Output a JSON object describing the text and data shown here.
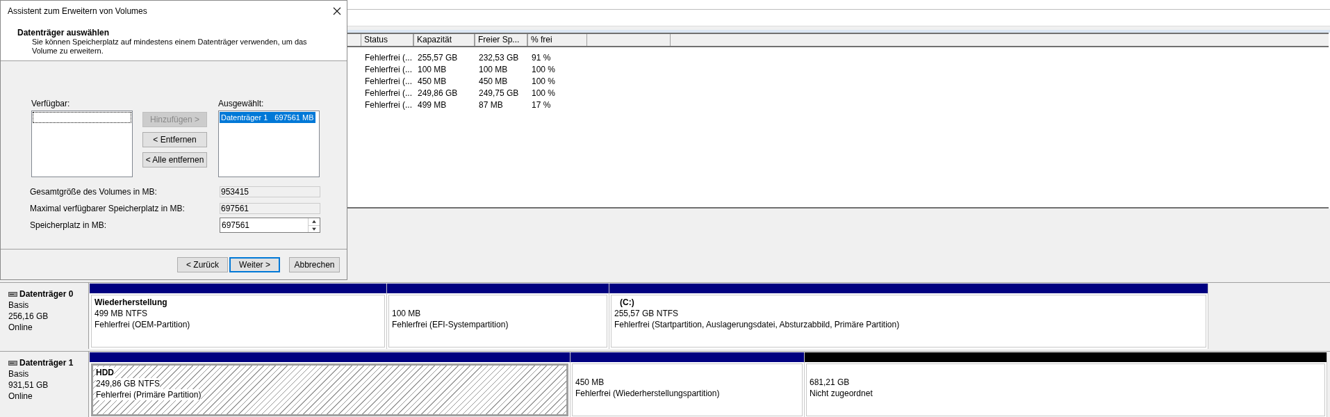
{
  "table": {
    "columns": [
      "Status",
      "Kapazität",
      "Freier Sp...",
      "% frei"
    ],
    "rows": [
      [
        "Fehlerfrei (...",
        "255,57 GB",
        "232,53 GB",
        "91 %"
      ],
      [
        "Fehlerfrei (...",
        "100 MB",
        "100 MB",
        "100 %"
      ],
      [
        "Fehlerfrei (...",
        "450 MB",
        "450 MB",
        "100 %"
      ],
      [
        "Fehlerfrei (...",
        "249,86 GB",
        "249,75 GB",
        "100 %"
      ],
      [
        "Fehlerfrei (...",
        "499 MB",
        "87 MB",
        "17 %"
      ]
    ]
  },
  "disks": [
    {
      "name": "Datenträger 0",
      "type": "Basis",
      "size": "256,16 GB",
      "state": "Online",
      "partitions": [
        {
          "kind": "primary",
          "selected": false,
          "label": "Wiederherstellung",
          "size": "499 MB NTFS",
          "status": "Fehlerfrei (OEM-Partition)"
        },
        {
          "kind": "primary",
          "selected": false,
          "size": "100 MB",
          "status": "Fehlerfrei (EFI-Systempartition)"
        },
        {
          "kind": "primary",
          "selected": false,
          "label": "(C:)",
          "size": "255,57 GB NTFS",
          "status": "Fehlerfrei (Startpartition, Auslagerungsdatei, Absturzabbild, Primäre Partition)"
        }
      ]
    },
    {
      "name": "Datenträger 1",
      "type": "Basis",
      "size": "931,51 GB",
      "state": "Online",
      "partitions": [
        {
          "kind": "primary",
          "selected": true,
          "label": "HDD",
          "size": "249,86 GB NTFS",
          "status": "Fehlerfrei (Primäre Partition)"
        },
        {
          "kind": "primary",
          "selected": false,
          "size": "450 MB",
          "status": "Fehlerfrei (Wiederherstellungspartition)"
        },
        {
          "kind": "unallocated",
          "selected": false,
          "size": "681,21 GB",
          "status": "Nicht zugeordnet"
        }
      ]
    }
  ],
  "dialog": {
    "title": "Assistent zum Erweitern von Volumes",
    "heading": "Datenträger auswählen",
    "description": "Sie können Speicherplatz auf mindestens einem Datenträger verwenden, um das Volume zu erweitern.",
    "available_label": "Verfügbar:",
    "selected_label": "Ausgewählt:",
    "selected_items": [
      {
        "name": "Datenträger 1",
        "size": "697561 MB",
        "selected": true
      }
    ],
    "move_buttons": [
      {
        "label": "Hinzufügen >",
        "disabled": true
      },
      {
        "label": "< Entfernen",
        "disabled": false
      },
      {
        "label": "< Alle entfernen",
        "disabled": false
      }
    ],
    "fields": [
      {
        "kind": "readonly",
        "label": "Gesamtgröße des Volumes in MB:",
        "value": "953415"
      },
      {
        "kind": "readonly",
        "label": "Maximal verfügbarer Speicherplatz in MB:",
        "value": "697561"
      },
      {
        "kind": "spin",
        "label": "Speicherplatz in MB:",
        "value": "697561"
      }
    ],
    "footer_buttons": [
      {
        "label": "< Zurück",
        "default": false
      },
      {
        "label": "Weiter >",
        "default": true
      },
      {
        "label": "Abbrechen",
        "default": false
      }
    ]
  }
}
